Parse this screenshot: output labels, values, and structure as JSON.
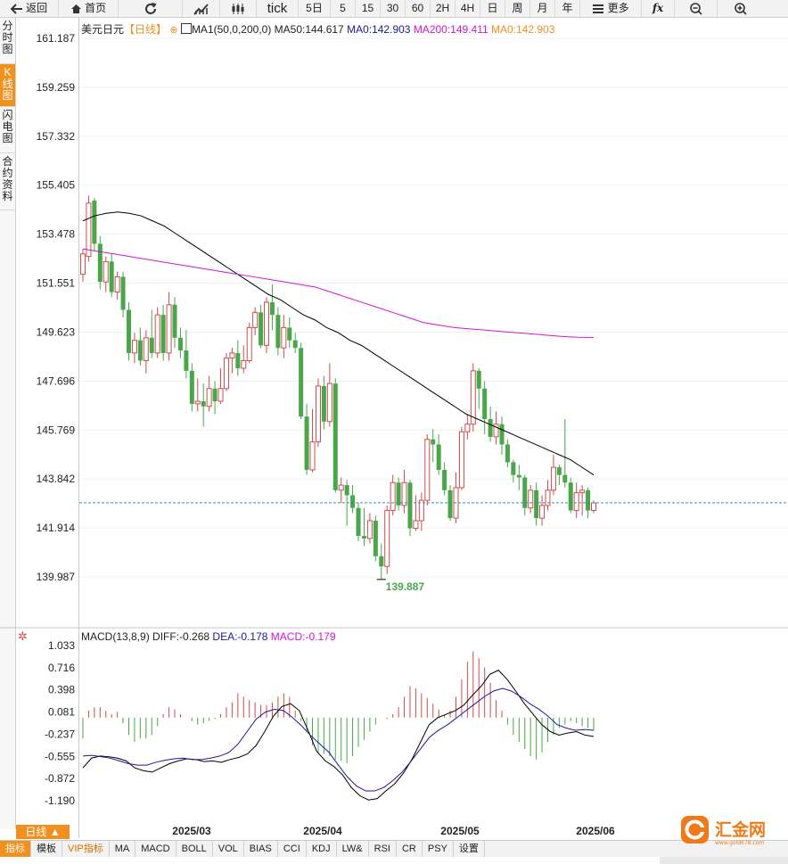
{
  "toolbar": {
    "back": "返回",
    "home": "首页",
    "refresh_icon": "refresh-icon",
    "chart_icon": "line-chart-icon",
    "candle_icon": "candlestick-icon",
    "tick": "tick",
    "periods": [
      "5日",
      "5",
      "15",
      "30",
      "60",
      "2H",
      "4H",
      "日",
      "周",
      "月",
      "年"
    ],
    "more": "更多",
    "fx": "fx",
    "zoom_out_icon": "zoom-out-icon",
    "zoom_in_icon": "zoom-in-icon"
  },
  "left_tabs": [
    {
      "label": "分时图",
      "active": false
    },
    {
      "label": "K线图",
      "active": true
    },
    {
      "label": "闪电图",
      "active": false
    },
    {
      "label": "合约资料",
      "active": false
    }
  ],
  "main": {
    "symbol": "美元日元",
    "period_tag": "【日线】",
    "ma_name": "MA1(50,0,200,0)",
    "ma50": "MA50:144.617",
    "ma0a": "MA0:142.903",
    "ma200": "MA200:149.411",
    "ma0b": "MA0:142.903",
    "y_ticks": [
      "161.187",
      "159.259",
      "157.332",
      "155.405",
      "153.478",
      "151.551",
      "149.623",
      "147.696",
      "145.769",
      "143.842",
      "141.914",
      "139.987"
    ],
    "low_label": "139.887",
    "current_price": 142.903
  },
  "macd": {
    "name": "MACD(13,8,9)",
    "diff": "DIFF:-0.268",
    "dea": "DEA:-0.178",
    "macd": "MACD:-0.179",
    "y_ticks": [
      "1.033",
      "0.716",
      "0.398",
      "0.081",
      "-0.237",
      "-0.555",
      "-0.872",
      "-1.190"
    ]
  },
  "x_labels": [
    "2025/03",
    "2025/04",
    "2025/05",
    "2025/06"
  ],
  "bottom": {
    "day_button": "日线 ▲",
    "tabs": [
      "指标",
      "模板",
      "VIP指标",
      "MA",
      "MACD",
      "BOLL",
      "VOL",
      "BIAS",
      "CCI",
      "KDJ",
      "LW&",
      "RSI",
      "CR",
      "PSY",
      "设置"
    ]
  },
  "logo": {
    "text": "汇金网",
    "sub": "www.gold678.com"
  },
  "colors": {
    "up": "#d24b4b",
    "down": "#4aa64a",
    "ma50": "#000000",
    "ma200": "#d214d2",
    "accent": "#f0901e",
    "dea": "#1a1a9a"
  },
  "chart_data": {
    "type": "candlestick",
    "y_range": [
      139.0,
      162.0
    ],
    "candles": [
      [
        151.9,
        152.7,
        151.6,
        152.9
      ],
      [
        152.6,
        154.7,
        152.4,
        155.0
      ],
      [
        154.8,
        153.1,
        152.8,
        154.9
      ],
      [
        153.1,
        151.6,
        151.3,
        153.4
      ],
      [
        151.6,
        152.4,
        151.2,
        152.6
      ],
      [
        152.4,
        151.2,
        151.0,
        152.7
      ],
      [
        151.2,
        151.8,
        150.9,
        152.0
      ],
      [
        151.8,
        150.5,
        150.2,
        152.0
      ],
      [
        150.5,
        148.8,
        148.5,
        150.8
      ],
      [
        148.8,
        149.3,
        148.4,
        149.6
      ],
      [
        149.3,
        148.5,
        148.3,
        149.8
      ],
      [
        148.5,
        149.4,
        148.0,
        149.7
      ],
      [
        149.4,
        148.8,
        148.6,
        150.5
      ],
      [
        148.8,
        150.3,
        148.6,
        150.6
      ],
      [
        150.3,
        148.8,
        148.5,
        150.7
      ],
      [
        148.8,
        150.7,
        148.5,
        151.2
      ],
      [
        150.7,
        149.4,
        149.0,
        151.0
      ],
      [
        149.4,
        148.9,
        148.6,
        149.8
      ],
      [
        148.9,
        148.1,
        147.8,
        149.7
      ],
      [
        148.1,
        146.8,
        146.5,
        148.4
      ],
      [
        146.8,
        146.9,
        146.5,
        147.8
      ],
      [
        146.9,
        146.7,
        145.9,
        147.6
      ],
      [
        146.7,
        147.4,
        146.5,
        147.9
      ],
      [
        147.4,
        146.9,
        146.4,
        147.7
      ],
      [
        146.9,
        147.4,
        146.8,
        148.2
      ],
      [
        147.4,
        148.6,
        147.3,
        148.8
      ],
      [
        148.6,
        148.8,
        148.0,
        149.0
      ],
      [
        148.8,
        148.2,
        147.9,
        149.3
      ],
      [
        148.2,
        148.5,
        148.0,
        149.1
      ],
      [
        148.5,
        149.8,
        148.4,
        150.0
      ],
      [
        149.8,
        150.4,
        149.5,
        150.6
      ],
      [
        150.4,
        149.1,
        149.0,
        150.7
      ],
      [
        149.1,
        150.8,
        148.8,
        151.0
      ],
      [
        150.8,
        150.3,
        149.7,
        151.5
      ],
      [
        150.3,
        149.0,
        148.7,
        150.6
      ],
      [
        149.0,
        149.8,
        148.6,
        150.3
      ],
      [
        149.8,
        149.3,
        149.0,
        150.2
      ],
      [
        149.3,
        149.0,
        148.8,
        149.6
      ],
      [
        149.0,
        146.3,
        146.2,
        149.2
      ],
      [
        146.3,
        144.2,
        144.0,
        146.8
      ],
      [
        144.2,
        145.3,
        144.1,
        146.6
      ],
      [
        145.3,
        147.5,
        145.1,
        147.8
      ],
      [
        147.5,
        146.1,
        145.8,
        147.9
      ],
      [
        146.1,
        147.6,
        145.9,
        148.4
      ],
      [
        147.6,
        143.4,
        143.3,
        147.8
      ],
      [
        143.4,
        143.6,
        142.9,
        143.9
      ],
      [
        143.6,
        143.2,
        142.0,
        143.8
      ],
      [
        143.2,
        142.7,
        142.5,
        143.6
      ],
      [
        142.7,
        141.6,
        141.4,
        142.9
      ],
      [
        141.6,
        141.5,
        141.2,
        142.7
      ],
      [
        141.5,
        142.2,
        141.3,
        142.5
      ],
      [
        142.2,
        140.8,
        140.6,
        142.4
      ],
      [
        140.8,
        140.4,
        139.9,
        141.3
      ],
      [
        140.4,
        142.6,
        140.1,
        142.8
      ],
      [
        142.6,
        143.7,
        142.4,
        144.0
      ],
      [
        143.7,
        142.8,
        142.6,
        143.9
      ],
      [
        142.8,
        143.7,
        142.5,
        144.2
      ],
      [
        143.7,
        141.9,
        141.6,
        143.8
      ],
      [
        141.9,
        142.2,
        141.8,
        143.2
      ],
      [
        142.2,
        143.0,
        141.8,
        143.3
      ],
      [
        143.0,
        145.4,
        142.8,
        145.6
      ],
      [
        145.4,
        145.2,
        144.5,
        145.8
      ],
      [
        145.2,
        144.2,
        144.0,
        145.6
      ],
      [
        144.2,
        143.4,
        143.2,
        144.5
      ],
      [
        143.4,
        142.3,
        142.2,
        143.6
      ],
      [
        142.3,
        143.5,
        142.1,
        144.1
      ],
      [
        143.5,
        145.7,
        143.4,
        145.9
      ],
      [
        145.7,
        146.0,
        145.4,
        146.4
      ],
      [
        146.0,
        148.1,
        145.7,
        148.4
      ],
      [
        148.1,
        147.4,
        146.6,
        148.2
      ],
      [
        147.4,
        146.2,
        145.6,
        147.7
      ],
      [
        146.2,
        145.5,
        145.3,
        146.7
      ],
      [
        145.5,
        146.0,
        145.2,
        146.5
      ],
      [
        146.0,
        145.2,
        144.8,
        146.3
      ],
      [
        145.2,
        144.5,
        144.3,
        145.4
      ],
      [
        144.5,
        144.0,
        143.7,
        144.6
      ],
      [
        144.0,
        143.9,
        143.4,
        144.4
      ],
      [
        143.9,
        142.7,
        142.4,
        144.0
      ],
      [
        142.7,
        143.4,
        142.5,
        143.6
      ],
      [
        143.4,
        142.3,
        142.0,
        143.7
      ],
      [
        142.3,
        142.8,
        142.0,
        143.2
      ],
      [
        142.8,
        143.4,
        142.6,
        143.8
      ],
      [
        143.4,
        144.3,
        143.2,
        144.8
      ],
      [
        144.3,
        144.0,
        143.6,
        144.4
      ],
      [
        144.0,
        143.7,
        143.5,
        146.2
      ],
      [
        143.7,
        142.6,
        142.5,
        143.9
      ],
      [
        142.6,
        143.3,
        142.3,
        143.7
      ],
      [
        143.3,
        143.4,
        142.4,
        143.6
      ],
      [
        143.4,
        142.6,
        142.3,
        143.5
      ],
      [
        142.6,
        142.9,
        142.5,
        143.0
      ]
    ],
    "ma50": [
      154.0,
      154.2,
      154.3,
      154.35,
      154.3,
      154.2,
      154.0,
      153.8,
      153.5,
      153.2,
      152.9,
      152.6,
      152.3,
      152.0,
      151.7,
      151.4,
      151.1,
      150.9,
      150.6,
      150.3,
      150.1,
      149.8,
      149.6,
      149.3,
      149.1,
      148.8,
      148.5,
      148.2,
      147.9,
      147.6,
      147.3,
      147.0,
      146.7,
      146.4,
      146.2,
      146.0,
      145.8,
      145.6,
      145.4,
      145.2,
      145.0,
      144.8,
      144.6,
      144.3,
      144.0
    ],
    "ma200": [
      152.9,
      152.8,
      152.7,
      152.6,
      152.5,
      152.4,
      152.3,
      152.2,
      152.1,
      152.0,
      151.9,
      151.8,
      151.7,
      151.6,
      151.5,
      151.4,
      151.2,
      151.0,
      150.8,
      150.6,
      150.4,
      150.2,
      150.0,
      149.9,
      149.8,
      149.75,
      149.7,
      149.65,
      149.6,
      149.55,
      149.5,
      149.45,
      149.42,
      149.41
    ],
    "macd_y_range": [
      -1.35,
      1.1
    ],
    "macd_hist": [
      -0.3,
      0.1,
      0.15,
      0.15,
      0.1,
      0.05,
      0.08,
      -0.08,
      -0.25,
      -0.35,
      -0.3,
      -0.3,
      -0.25,
      -0.12,
      0.05,
      0.15,
      0.12,
      0.05,
      0.0,
      -0.05,
      -0.1,
      -0.08,
      -0.05,
      -0.02,
      0.05,
      0.15,
      0.22,
      0.35,
      0.3,
      0.25,
      0.22,
      0.18,
      0.18,
      0.22,
      0.3,
      0.35,
      0.3,
      0.1,
      -0.05,
      -0.2,
      -0.4,
      -0.5,
      -0.52,
      -0.55,
      -0.6,
      -0.62,
      -0.65,
      -0.55,
      -0.42,
      -0.32,
      -0.2,
      -0.1,
      0.0,
      -0.02,
      0.05,
      0.15,
      0.3,
      0.45,
      0.42,
      0.35,
      0.28,
      0.2,
      0.12,
      0.04,
      0.1,
      0.3,
      0.55,
      0.8,
      0.95,
      0.85,
      0.72,
      0.5,
      0.25,
      0.1,
      -0.1,
      -0.25,
      -0.35,
      -0.45,
      -0.55,
      -0.6,
      -0.5,
      -0.35,
      -0.25,
      -0.15,
      -0.1,
      -0.05,
      -0.08,
      -0.12,
      -0.15,
      -0.18
    ],
    "macd_diff": [
      -0.72,
      -0.58,
      -0.55,
      -0.56,
      -0.58,
      -0.62,
      -0.72,
      -0.76,
      -0.78,
      -0.72,
      -0.66,
      -0.62,
      -0.59,
      -0.6,
      -0.63,
      -0.62,
      -0.64,
      -0.6,
      -0.57,
      -0.52,
      -0.4,
      -0.2,
      0.02,
      0.16,
      0.2,
      0.1,
      -0.18,
      -0.48,
      -0.62,
      -0.7,
      -0.82,
      -1.0,
      -1.12,
      -1.18,
      -1.16,
      -1.05,
      -0.95,
      -0.8,
      -0.6,
      -0.35,
      -0.1,
      0.0,
      0.05,
      0.1,
      0.18,
      0.32,
      0.45,
      0.62,
      0.68,
      0.55,
      0.38,
      0.2,
      0.05,
      -0.1,
      -0.2,
      -0.25,
      -0.22,
      -0.2,
      -0.25,
      -0.27
    ],
    "macd_dea": [
      -0.55,
      -0.54,
      -0.56,
      -0.58,
      -0.62,
      -0.66,
      -0.68,
      -0.68,
      -0.64,
      -0.61,
      -0.59,
      -0.58,
      -0.6,
      -0.6,
      -0.58,
      -0.55,
      -0.5,
      -0.38,
      -0.2,
      -0.02,
      0.08,
      0.12,
      0.1,
      0.0,
      -0.12,
      -0.26,
      -0.38,
      -0.5,
      -0.68,
      -0.85,
      -0.98,
      -1.05,
      -1.05,
      -1.0,
      -0.9,
      -0.78,
      -0.62,
      -0.45,
      -0.28,
      -0.18,
      -0.1,
      0.0,
      0.1,
      0.2,
      0.3,
      0.38,
      0.42,
      0.38,
      0.3,
      0.2,
      0.12,
      0.02,
      -0.1,
      -0.15,
      -0.18,
      -0.17,
      -0.18
    ]
  }
}
